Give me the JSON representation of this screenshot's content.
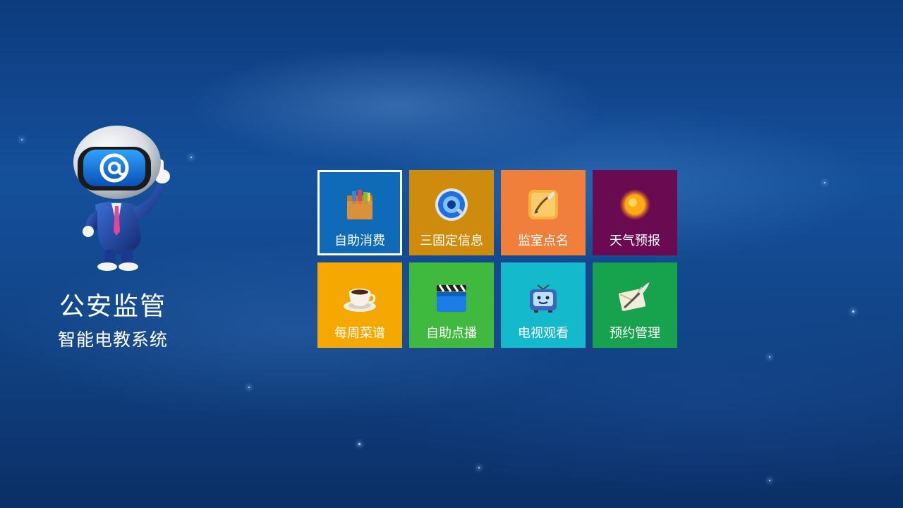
{
  "brand": {
    "title": "公安监管",
    "subtitle": "智能电教系统",
    "mascot_icon": "at-sign-robot-mascot"
  },
  "tiles": [
    {
      "label": "自助消费",
      "icon": "shopping-bag-icon",
      "color": "#0f6ab8",
      "selected": true
    },
    {
      "label": "三固定信息",
      "icon": "quicktime-disc-icon",
      "color": "#cf8b0c",
      "selected": false
    },
    {
      "label": "监室点名",
      "icon": "pen-paper-icon",
      "color": "#ef7f3a",
      "selected": false
    },
    {
      "label": "天气预报",
      "icon": "sun-icon",
      "color": "#6a0a50",
      "selected": false
    },
    {
      "label": "每周菜谱",
      "icon": "coffee-cup-icon",
      "color": "#f4a800",
      "selected": false
    },
    {
      "label": "自助点播",
      "icon": "clapperboard-icon",
      "color": "#3fba3f",
      "selected": false
    },
    {
      "label": "电视观看",
      "icon": "retro-tv-icon",
      "color": "#14b9cb",
      "selected": false
    },
    {
      "label": "预约管理",
      "icon": "letter-quill-icon",
      "color": "#17a24d",
      "selected": false
    }
  ]
}
